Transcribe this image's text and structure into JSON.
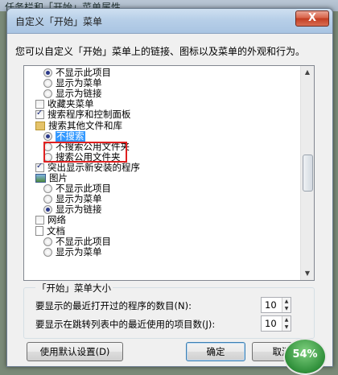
{
  "background": {
    "title": "任务栏和「开始」菜单属性"
  },
  "dialog": {
    "title": "自定义「开始」菜单",
    "close_label": "X",
    "description": "您可以自定义「开始」菜单上的链接、图标以及菜单的外观和行为。"
  },
  "list": {
    "items": [
      {
        "label": "不显示此项目",
        "kind": "radio",
        "state": "selected"
      },
      {
        "label": "显示为菜单",
        "kind": "radio",
        "state": "off"
      },
      {
        "label": "显示为链接",
        "kind": "radio",
        "state": "off"
      },
      {
        "label": "收藏夹菜单",
        "kind": "checkbox",
        "state": "off"
      },
      {
        "label": "搜索程序和控制面板",
        "kind": "checkbox",
        "state": "checked"
      },
      {
        "label": "搜索其他文件和库",
        "kind": "folder",
        "state": ""
      },
      {
        "label": "不搜索",
        "kind": "radio",
        "state": "selected"
      },
      {
        "label": "不搜索公用文件夹",
        "kind": "radio",
        "state": "off"
      },
      {
        "label": "搜索公用文件夹",
        "kind": "radio",
        "state": "off"
      },
      {
        "label": "突出显示新安装的程序",
        "kind": "checkbox",
        "state": "checked"
      },
      {
        "label": "图片",
        "kind": "picture",
        "state": ""
      },
      {
        "label": "不显示此项目",
        "kind": "radio",
        "state": "off"
      },
      {
        "label": "显示为菜单",
        "kind": "radio",
        "state": "off"
      },
      {
        "label": "显示为链接",
        "kind": "radio",
        "state": "selected"
      },
      {
        "label": "网络",
        "kind": "checkbox",
        "state": "off"
      },
      {
        "label": "文档",
        "kind": "document",
        "state": ""
      },
      {
        "label": "不显示此项目",
        "kind": "radio",
        "state": "off"
      },
      {
        "label": "显示为菜单",
        "kind": "radio",
        "state": "off"
      }
    ],
    "scroll_up": "▲",
    "scroll_down": "▼"
  },
  "size_group": {
    "legend": "「开始」菜单大小",
    "recent_programs_label": "要显示的最近打开过的程序的数目(N):",
    "recent_programs_value": "10",
    "jumplist_label": "要显示在跳转列表中的最近使用的项目数(J):",
    "jumplist_value": "10"
  },
  "buttons": {
    "defaults": "使用默认设置(D)",
    "ok": "确定",
    "cancel": "取消"
  },
  "badge": {
    "text": "54%",
    "value_percent": 54
  }
}
